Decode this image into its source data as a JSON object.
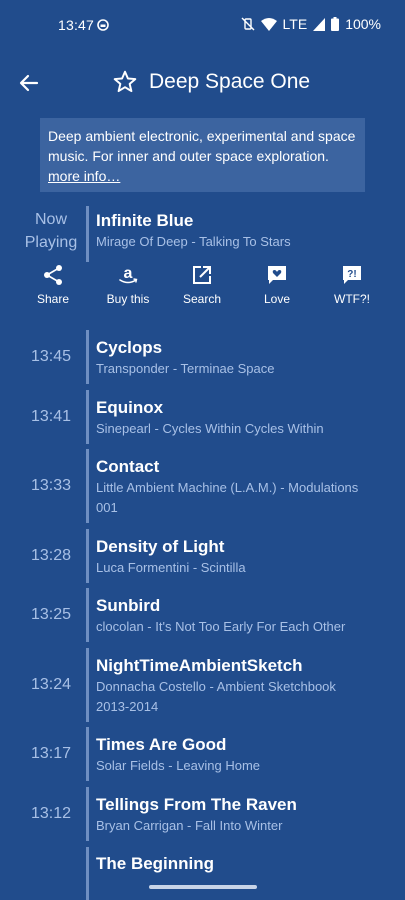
{
  "status_bar": {
    "time": "13:47",
    "network": "LTE",
    "battery": "100%"
  },
  "app_bar": {
    "title": "Deep Space One"
  },
  "description": {
    "text": "Deep ambient electronic, experimental and space music. For inner and outer space exploration.",
    "more_link": "more info…"
  },
  "now_playing": {
    "label_line1": "Now",
    "label_line2": "Playing",
    "title": "Infinite Blue",
    "subtitle": "Mirage Of Deep - Talking To Stars"
  },
  "actions": [
    {
      "label": "Share",
      "icon": "share-icon"
    },
    {
      "label": "Buy this",
      "icon": "amazon-icon"
    },
    {
      "label": "Search",
      "icon": "open-external-icon"
    },
    {
      "label": "Love",
      "icon": "love-message-icon"
    },
    {
      "label": "WTF?!",
      "icon": "wtf-message-icon"
    }
  ],
  "history": [
    {
      "time": "13:45",
      "title": "Cyclops",
      "subtitle_line1": "Transponder - Terminae Space",
      "subtitle_line2": ""
    },
    {
      "time": "13:41",
      "title": "Equinox",
      "subtitle_line1": "Sinepearl - Cycles Within Cycles Within",
      "subtitle_line2": ""
    },
    {
      "time": "13:33",
      "title": "Contact",
      "subtitle_line1": "Little Ambient Machine (L.A.M.) - Modulations",
      "subtitle_line2": "001"
    },
    {
      "time": "13:28",
      "title": "Density of Light",
      "subtitle_line1": "Luca Formentini - Scintilla",
      "subtitle_line2": ""
    },
    {
      "time": "13:25",
      "title": "Sunbird",
      "subtitle_line1": "clocolan - It's Not Too Early For Each Other",
      "subtitle_line2": ""
    },
    {
      "time": "13:24",
      "title": "NightTimeAmbientSketch",
      "subtitle_line1": "Donnacha Costello - Ambient Sketchbook",
      "subtitle_line2": "2013-2014"
    },
    {
      "time": "13:17",
      "title": "Times Are Good",
      "subtitle_line1": "Solar Fields - Leaving Home",
      "subtitle_line2": ""
    },
    {
      "time": "13:12",
      "title": "Tellings From The Raven",
      "subtitle_line1": "Bryan Carrigan - Fall Into Winter",
      "subtitle_line2": ""
    },
    {
      "time": "",
      "title": "The Beginning",
      "subtitle_line1": "",
      "subtitle_line2": ""
    }
  ],
  "colors": {
    "background": "#214c8c",
    "description_box": "#3c64a0",
    "muted_text": "#a8c0e6",
    "divider": "#6f8fc2"
  }
}
